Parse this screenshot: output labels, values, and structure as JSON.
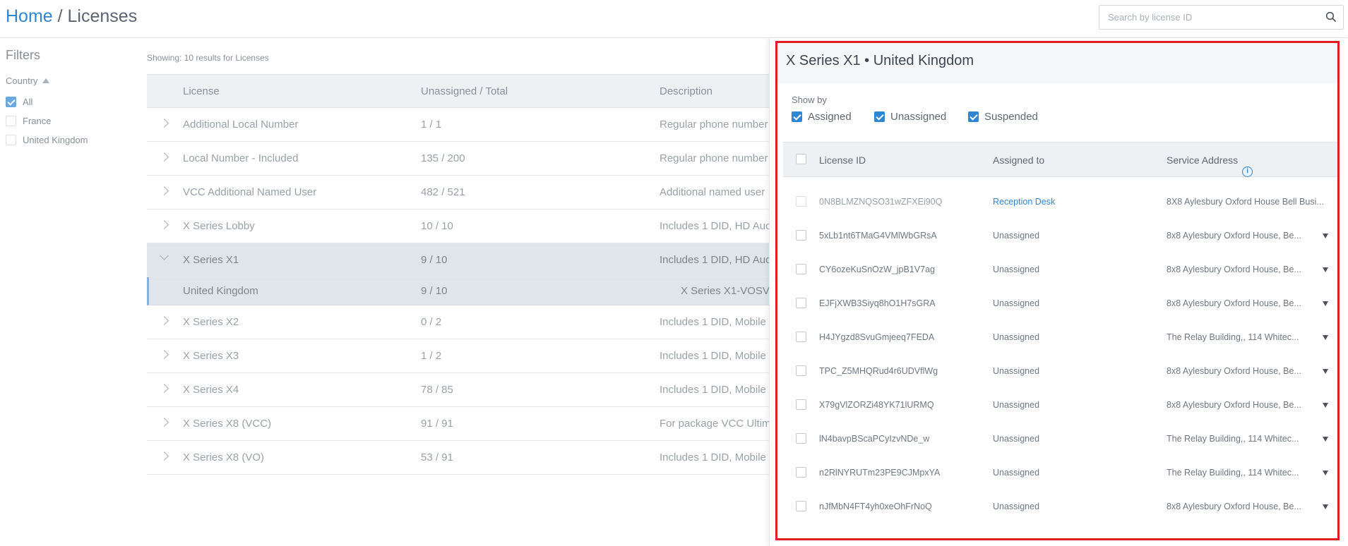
{
  "breadcrumb": {
    "home": "Home",
    "sep": " / ",
    "current": "Licenses"
  },
  "search": {
    "placeholder": "Search by license ID",
    "icon": "search-icon"
  },
  "filters": {
    "title": "Filters",
    "country_label": "Country",
    "options": [
      {
        "label": "All",
        "checked": true
      },
      {
        "label": "France",
        "checked": false
      },
      {
        "label": "United Kingdom",
        "checked": false
      }
    ]
  },
  "results_text": "Showing: 10 results for Licenses",
  "table": {
    "headers": {
      "license": "License",
      "count": "Unassigned / Total",
      "description": "Description"
    },
    "rows": [
      {
        "license": "Additional Local Number",
        "count": "1 / 1",
        "description": "Regular phone number"
      },
      {
        "license": "Local Number - Included",
        "count": "135 / 200",
        "description": "Regular phone number"
      },
      {
        "license": "VCC Additional Named User",
        "count": "482 / 521",
        "description": "Additional named user"
      },
      {
        "license": "X Series Lobby",
        "count": "10 / 10",
        "description": "Includes 1 DID, HD Aud"
      },
      {
        "license": "X Series X1",
        "count": "9 / 10",
        "description": "Includes 1 DID, HD Aud",
        "expanded": true
      },
      {
        "license": "X Series X2",
        "count": "0 / 2",
        "description": "Includes 1 DID, Mobile"
      },
      {
        "license": "X Series X3",
        "count": "1 / 2",
        "description": "Includes 1 DID, Mobile"
      },
      {
        "license": "X Series X4",
        "count": "78 / 85",
        "description": "Includes 1 DID, Mobile"
      },
      {
        "license": "X Series X8 (VCC)",
        "count": "91 / 91",
        "description": "For package VCC Ultim"
      },
      {
        "license": "X Series X8 (VO)",
        "count": "53 / 91",
        "description": "Includes 1 DID, Mobile"
      }
    ],
    "subrow": {
      "license": "United Kingdom",
      "count": "9 / 10",
      "description": "X Series X1-VOSV"
    }
  },
  "drawer": {
    "title": "X Series X1 • United Kingdom",
    "show_by_label": "Show by",
    "show_by": [
      {
        "label": "Assigned",
        "checked": true
      },
      {
        "label": "Unassigned",
        "checked": true
      },
      {
        "label": "Suspended",
        "checked": true
      }
    ],
    "headers": {
      "license_id": "License ID",
      "assigned_to": "Assigned to",
      "service_address": "Service Address"
    },
    "rows": [
      {
        "id": "0N8BLMZNQSO31wZFXEi90Q",
        "assigned": "Reception Desk",
        "address": "8X8 Aylesbury Oxford House Bell Busi...",
        "link": true
      },
      {
        "id": "5xLb1nt6TMaG4VMlWbGRsA",
        "assigned": "Unassigned",
        "address": "8x8 Aylesbury Oxford House, Be..."
      },
      {
        "id": "CY6ozeKuSnOzW_jpB1V7ag",
        "assigned": "Unassigned",
        "address": "8x8 Aylesbury Oxford House, Be..."
      },
      {
        "id": "EJFjXWB3Siyq8hO1H7sGRA",
        "assigned": "Unassigned",
        "address": "8x8 Aylesbury Oxford House, Be..."
      },
      {
        "id": "H4JYgzd8SvuGmjeeq7FEDA",
        "assigned": "Unassigned",
        "address": "The Relay Building,, 114 Whitec..."
      },
      {
        "id": "TPC_Z5MHQRud4r6UDVflWg",
        "assigned": "Unassigned",
        "address": "8x8 Aylesbury Oxford House, Be..."
      },
      {
        "id": "X79gVlZORZi48YK71lURMQ",
        "assigned": "Unassigned",
        "address": "8x8 Aylesbury Oxford House, Be..."
      },
      {
        "id": "lN4bavpBScaPCyIzvNDe_w",
        "assigned": "Unassigned",
        "address": "The Relay Building,, 114 Whitec..."
      },
      {
        "id": "n2RlNYRUTm23PE9CJMpxYA",
        "assigned": "Unassigned",
        "address": "The Relay Building,, 114 Whitec..."
      },
      {
        "id": "nJfMbN4FT4yh0xeOhFrNoQ",
        "assigned": "Unassigned",
        "address": "8x8 Aylesbury Oxford House, Be..."
      }
    ]
  },
  "colors": {
    "accent": "#2f86d3",
    "highlight_frame": "#e31b23"
  }
}
